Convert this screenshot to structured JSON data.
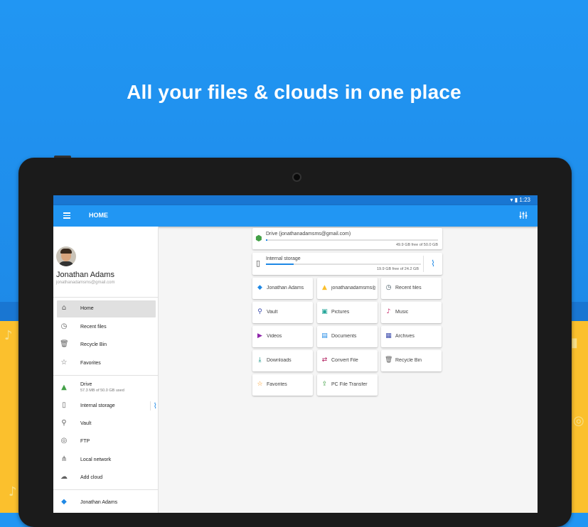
{
  "headline": "All your files & clouds in one place",
  "status": {
    "time": "1:23",
    "icons": "▾ ▮"
  },
  "appbar": {
    "title": "HOME"
  },
  "drawer": {
    "user": {
      "name": "Jonathan Adams",
      "email": "jonathanadamsms@gmail.com"
    },
    "items": [
      {
        "label": "Home",
        "icon": "⌂"
      },
      {
        "label": "Recent files",
        "icon": "◷"
      },
      {
        "label": "Recycle Bin",
        "icon": "🗑"
      },
      {
        "label": "Favorites",
        "icon": "☆"
      }
    ],
    "storage": [
      {
        "label": "Drive",
        "sub": "57.3 MB of 50.0 GB used",
        "icon": "▲"
      },
      {
        "label": "Internal storage",
        "icon": "▯"
      },
      {
        "label": "Vault",
        "icon": "⚲"
      },
      {
        "label": "FTP",
        "icon": "◎"
      },
      {
        "label": "Local network",
        "icon": "⋔"
      },
      {
        "label": "Add cloud",
        "icon": "☁"
      }
    ],
    "accounts": [
      {
        "label": "Jonathan Adams",
        "icon": "◆"
      }
    ]
  },
  "storage_cards": [
    {
      "title": "Drive (jonathanadamsms@gmail.com)",
      "free": "49.9 GB free of 50.0 GB",
      "fill": 0.01
    },
    {
      "title": "Internal storage",
      "free": "19.9 GB free of 24.2 GB",
      "fill": 0.18
    }
  ],
  "tiles": [
    {
      "label": "Jonathan Adams",
      "icon": "◆",
      "color": "#1e88e5"
    },
    {
      "label": "jonathanadamsms@",
      "icon": "▲",
      "color": "#fbc02d"
    },
    {
      "label": "Recent files",
      "icon": "◷",
      "color": "#455a64"
    },
    {
      "label": "Vault",
      "icon": "⚲",
      "color": "#3949ab"
    },
    {
      "label": "Pictures",
      "icon": "▣",
      "color": "#26a69a"
    },
    {
      "label": "Music",
      "icon": "♪",
      "color": "#c2185b"
    },
    {
      "label": "Videos",
      "icon": "▶",
      "color": "#8e24aa"
    },
    {
      "label": "Documents",
      "icon": "▤",
      "color": "#1e88e5"
    },
    {
      "label": "Archives",
      "icon": "▦",
      "color": "#3949ab"
    },
    {
      "label": "Downloads",
      "icon": "⤓",
      "color": "#00897b"
    },
    {
      "label": "Convert File",
      "icon": "⇄",
      "color": "#ad1457"
    },
    {
      "label": "Recycle Bin",
      "icon": "🗑",
      "color": "#616161"
    },
    {
      "label": "Favorites",
      "icon": "☆",
      "color": "#fb8c00"
    },
    {
      "label": "PC File Transfer",
      "icon": "⇪",
      "color": "#43a047"
    }
  ],
  "colors": {
    "blue": "#2196f3",
    "dark_blue": "#1976d2",
    "yellow": "#fbc02d"
  }
}
